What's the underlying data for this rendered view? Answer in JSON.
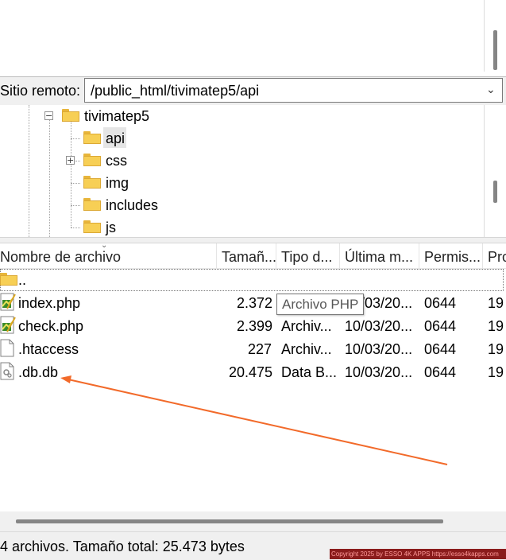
{
  "remote_site": {
    "label": "Sitio remoto:",
    "path": "/public_html/tivimatep5/api"
  },
  "tree": {
    "root": {
      "label": "tivimatep5",
      "expanded": true
    },
    "children": [
      {
        "label": "api",
        "selected": true,
        "has_expander": false
      },
      {
        "label": "css",
        "selected": false,
        "has_expander": true
      },
      {
        "label": "img",
        "selected": false,
        "has_expander": false
      },
      {
        "label": "includes",
        "selected": false,
        "has_expander": false
      },
      {
        "label": "js",
        "selected": false,
        "has_expander": false
      }
    ]
  },
  "file_list": {
    "columns": [
      "Nombre de archivo",
      "Tamañ...",
      "Tipo d...",
      "Última m...",
      "Permis...",
      "Pro"
    ],
    "parent_entry": "..",
    "rows": [
      {
        "name": "index.php",
        "size": "2.372",
        "type": "Archivo PHP",
        "modified": "10/03/20...",
        "perms": "0644",
        "owner": "19",
        "icon": "php-file-icon"
      },
      {
        "name": "check.php",
        "size": "2.399",
        "type": "Archiv...",
        "modified": "10/03/20...",
        "perms": "0644",
        "owner": "19",
        "icon": "php-file-icon"
      },
      {
        "name": ".htaccess",
        "size": "227",
        "type": "Archiv...",
        "modified": "10/03/20...",
        "perms": "0644",
        "owner": "19",
        "icon": "blank-file-icon"
      },
      {
        "name": ".db.db",
        "size": "20.475",
        "type": "Data B...",
        "modified": "10/03/20...",
        "perms": "0644",
        "owner": "19",
        "icon": "db-file-icon"
      }
    ],
    "tooltip": "Archivo PHP"
  },
  "status": {
    "text": "4 archivos. Tamaño total: 25.473 bytes"
  },
  "watermark": "Copyright 2025 by ESSO 4K APPS https://esso4kapps.com",
  "colors": {
    "annotation_arrow": "#f26a2a",
    "folder": "#f7cf55",
    "watermark_bg": "#8a1c1c"
  }
}
